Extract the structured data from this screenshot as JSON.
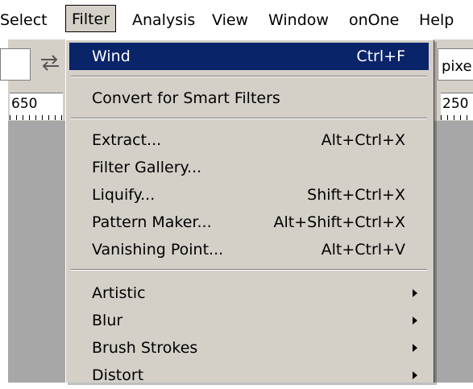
{
  "menubar": {
    "items": [
      "Select",
      "Filter",
      "Analysis",
      "View",
      "Window",
      "onOne",
      "Help"
    ],
    "active": "Filter"
  },
  "toolbar": {
    "units_text": "pixe"
  },
  "ruler": {
    "left_number": "650",
    "right_number": "250"
  },
  "filter_menu": {
    "highlight_color": "#0a246a",
    "items": [
      {
        "label": "Wind",
        "shortcut": "Ctrl+F",
        "highlighted": true
      },
      {
        "label": "Convert for Smart Filters",
        "shortcut": ""
      },
      {
        "label": "Extract...",
        "shortcut": "Alt+Ctrl+X"
      },
      {
        "label": "Filter Gallery...",
        "shortcut": ""
      },
      {
        "label": "Liquify...",
        "shortcut": "Shift+Ctrl+X"
      },
      {
        "label": "Pattern Maker...",
        "shortcut": "Alt+Shift+Ctrl+X"
      },
      {
        "label": "Vanishing Point...",
        "shortcut": "Alt+Ctrl+V"
      },
      {
        "label": "Artistic",
        "submenu": true
      },
      {
        "label": "Blur",
        "submenu": true
      },
      {
        "label": "Brush Strokes",
        "submenu": true
      },
      {
        "label": "Distort",
        "submenu": true
      }
    ]
  }
}
